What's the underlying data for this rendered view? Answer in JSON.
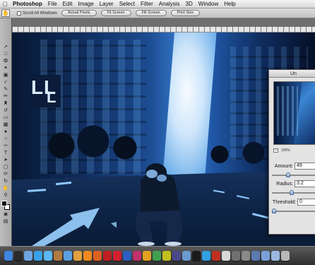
{
  "menubar": {
    "app_name": "Photoshop",
    "items": [
      "File",
      "Edit",
      "Image",
      "Layer",
      "Select",
      "Filter",
      "Analysis",
      "3D",
      "Window",
      "Help"
    ]
  },
  "options_bar": {
    "scroll_all_windows": "Scroll All Windows",
    "buttons": [
      "Actual Pixels",
      "Fit Screen",
      "Fill Screen",
      "Print Size"
    ]
  },
  "sign": {
    "letters": [
      "L",
      "L",
      "L"
    ]
  },
  "dialog": {
    "title": "Un",
    "zoom_percent": "100%",
    "amount_label": "Amount:",
    "amount_value": "49",
    "radius_label": "Radius:",
    "radius_value": "3.2",
    "threshold_label": "Threshold:",
    "threshold_value": "0",
    "amount_level": 0.35,
    "radius_level": 0.45,
    "threshold_level": 0.0
  },
  "dock": {
    "icons": [
      {
        "name": "finder-icon",
        "color": "#3f86e0"
      },
      {
        "name": "dashboard-icon",
        "color": "#2a2a2a"
      },
      {
        "name": "mail-icon",
        "color": "#6fa6e0"
      },
      {
        "name": "safari-icon",
        "color": "#3aa0e8"
      },
      {
        "name": "ichat-icon",
        "color": "#5bb8f0"
      },
      {
        "name": "address-book-icon",
        "color": "#b07a40"
      },
      {
        "name": "itunes-icon",
        "color": "#5aa0e0"
      },
      {
        "name": "iphoto-icon",
        "color": "#e0a040"
      },
      {
        "name": "vlc-icon",
        "color": "#f08a20"
      },
      {
        "name": "firefox-icon",
        "color": "#e06020"
      },
      {
        "name": "acrobat-icon",
        "color": "#c02020"
      },
      {
        "name": "flash-icon",
        "color": "#d02030"
      },
      {
        "name": "photoshop-icon",
        "color": "#2a5fbf"
      },
      {
        "name": "indesign-icon",
        "color": "#c0306a"
      },
      {
        "name": "illustrator-icon",
        "color": "#e0a020"
      },
      {
        "name": "dreamweaver-icon",
        "color": "#40a050"
      },
      {
        "name": "fireworks-icon",
        "color": "#c0c020"
      },
      {
        "name": "bridge-icon",
        "color": "#4a4a8a"
      },
      {
        "name": "preview-icon",
        "color": "#6a9ad0"
      },
      {
        "name": "terminal-icon",
        "color": "#1a1a1a"
      },
      {
        "name": "skype-icon",
        "color": "#30a0e0"
      },
      {
        "name": "filezilla-icon",
        "color": "#c03020"
      },
      {
        "name": "textedit-icon",
        "color": "#d8d8d8"
      },
      {
        "name": "calculator-icon",
        "color": "#707070"
      },
      {
        "name": "system-preferences-icon",
        "color": "#8a8a8a"
      },
      {
        "name": "utility-icon",
        "color": "#5a7ab0"
      },
      {
        "name": "downloads-stack-icon",
        "color": "#7aa0d8"
      },
      {
        "name": "documents-stack-icon",
        "color": "#9ab8e0"
      },
      {
        "name": "trash-icon",
        "color": "#b8b8b8"
      }
    ]
  }
}
